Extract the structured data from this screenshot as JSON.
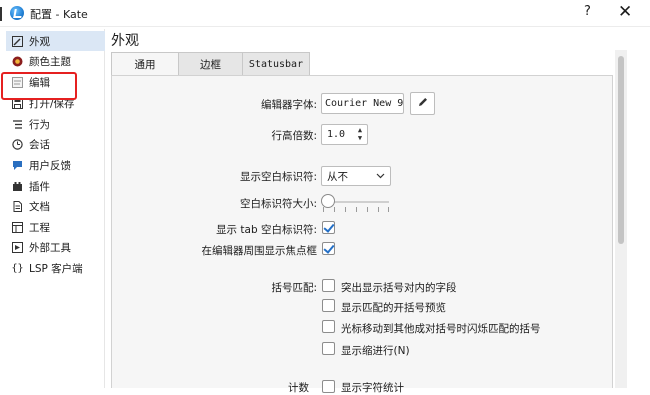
{
  "window": {
    "title": "配置 - Kate",
    "help_label": "?",
    "close_label": "✕"
  },
  "sidebar": {
    "items": [
      {
        "label": "外观",
        "icon": "appearance-icon"
      },
      {
        "label": "颜色主题",
        "icon": "color-theme-icon"
      },
      {
        "label": "编辑",
        "icon": "edit-icon"
      },
      {
        "label": "打开/保存",
        "icon": "open-save-icon"
      },
      {
        "label": "行为",
        "icon": "behavior-icon"
      },
      {
        "label": "会话",
        "icon": "session-icon"
      },
      {
        "label": "用户反馈",
        "icon": "feedback-icon"
      },
      {
        "label": "插件",
        "icon": "plugin-icon"
      },
      {
        "label": "文档",
        "icon": "document-icon"
      },
      {
        "label": "工程",
        "icon": "project-icon"
      },
      {
        "label": "外部工具",
        "icon": "external-tools-icon"
      },
      {
        "label": "LSP 客户端",
        "icon": "lsp-icon"
      }
    ],
    "selected": "外观",
    "highlighted": "编辑",
    "highlight_color": "#e52020"
  },
  "main": {
    "title": "外观",
    "tabs": [
      {
        "label": "通用",
        "active": true
      },
      {
        "label": "边框",
        "active": false
      },
      {
        "label": "Statusbar",
        "active": false
      }
    ],
    "editor_font": {
      "label": "编辑器字体:",
      "value": "Courier New 9"
    },
    "line_height": {
      "label": "行高倍数:",
      "value": "1.0"
    },
    "whitespace_indicator": {
      "label": "显示空白标识符:",
      "value": "从不",
      "options_visible": [
        "从不"
      ]
    },
    "whitespace_size": {
      "label": "空白标识符大小:",
      "value": 0
    },
    "show_tab_indicator": {
      "label": "显示 tab 空白标识符:",
      "checked": true
    },
    "focus_frame": {
      "label": "在编辑器周围显示焦点框",
      "checked": true
    },
    "bracket_matching": {
      "label": "括号匹配:",
      "options": [
        {
          "label": "突出显示括号对内的字段",
          "checked": false
        },
        {
          "label": "显示匹配的开括号预览",
          "checked": false
        },
        {
          "label": "光标移动到其他成对括号时闪烁匹配的括号",
          "checked": false
        },
        {
          "label": "显示缩进行(N)",
          "checked": false
        }
      ]
    },
    "partial_row": {
      "label": "计数",
      "option": "显示字符统计"
    }
  },
  "colors": {
    "accent": "#2470c7",
    "selection": "#dbe7f5"
  }
}
